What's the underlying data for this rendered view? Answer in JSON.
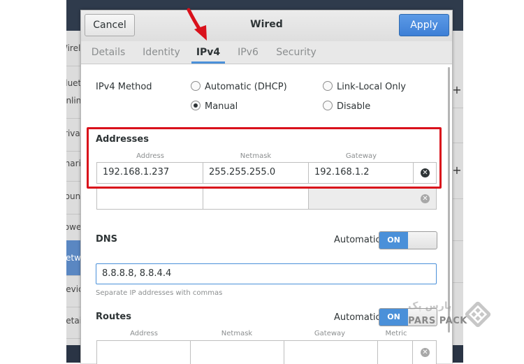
{
  "background": {
    "sidebar_items": [
      {
        "label": "Wireless",
        "selected": false
      },
      {
        "label": "Bluetooth",
        "selected": false
      },
      {
        "label": "Online",
        "selected": false
      },
      {
        "label": "Privacy",
        "selected": false
      },
      {
        "label": "Sharing",
        "selected": false
      },
      {
        "label": "Sound",
        "selected": false
      },
      {
        "label": "Power",
        "selected": false
      },
      {
        "label": "Network",
        "selected": true
      },
      {
        "label": "Devices",
        "selected": false
      },
      {
        "label": "Details",
        "selected": false
      }
    ],
    "right_plus_label": "+"
  },
  "dialog": {
    "title": "Wired",
    "cancel_label": "Cancel",
    "apply_label": "Apply",
    "tabs": [
      {
        "label": "Details",
        "active": false
      },
      {
        "label": "Identity",
        "active": false
      },
      {
        "label": "IPv4",
        "active": true
      },
      {
        "label": "IPv6",
        "active": false
      },
      {
        "label": "Security",
        "active": false
      }
    ]
  },
  "ipv4": {
    "method_label": "IPv4 Method",
    "methods": [
      {
        "label": "Automatic (DHCP)",
        "selected": false
      },
      {
        "label": "Link-Local Only",
        "selected": false
      },
      {
        "label": "Manual",
        "selected": true
      },
      {
        "label": "Disable",
        "selected": false
      }
    ]
  },
  "addresses": {
    "section_label": "Addresses",
    "col_address": "Address",
    "col_netmask": "Netmask",
    "col_gateway": "Gateway",
    "rows": [
      {
        "address": "192.168.1.237",
        "netmask": "255.255.255.0",
        "gateway": "192.168.1.2"
      },
      {
        "address": "",
        "netmask": "",
        "gateway": ""
      }
    ],
    "remove_glyph": "✕"
  },
  "dns": {
    "section_label": "DNS",
    "automatic_label": "Automatic",
    "toggle_label": "ON",
    "value": "8.8.8.8, 8.8.4.4",
    "hint": "Separate IP addresses with commas"
  },
  "routes": {
    "section_label": "Routes",
    "automatic_label": "Automatic",
    "toggle_label": "ON",
    "col_address": "Address",
    "col_netmask": "Netmask",
    "col_gateway": "Gateway",
    "col_metric": "Metric"
  },
  "watermark": {
    "text_latin": "PARS PACK",
    "text_persian": "پارس پک"
  },
  "colors": {
    "accent": "#4a90d9",
    "annotation_red": "#d9111b",
    "apply_blue": "#3d7fd6"
  }
}
